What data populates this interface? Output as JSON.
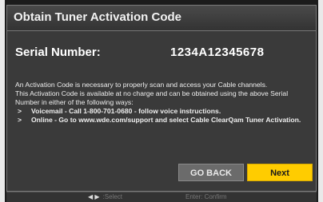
{
  "dialog": {
    "title": "Obtain Tuner Activation Code",
    "serial_label": "Serial Number:",
    "serial_value": "1234A12345678",
    "paragraphs": [
      "An Activation Code is necessary to properly scan and access your Cable channels.",
      "This Activation Code is available at no charge and can be obtained using the above Serial Number in either of the following ways:"
    ],
    "bullets": [
      "Voicemail - Call 1-800-701-0680 - follow voice instructions.",
      "Online - Go to www.wde.com/support and select Cable ClearQam Tuner Activation."
    ],
    "buttons": {
      "back_label": "GO BACK",
      "next_label": "Next"
    }
  },
  "hints": {
    "select_icon": "left-right-arrows-icon",
    "select_label": ":Select",
    "confirm_label": "Enter: Confirm"
  },
  "colors": {
    "dialog_bg": "#3a3a3a",
    "next_button": "#ffcc00",
    "back_button": "#6b6b6b"
  }
}
